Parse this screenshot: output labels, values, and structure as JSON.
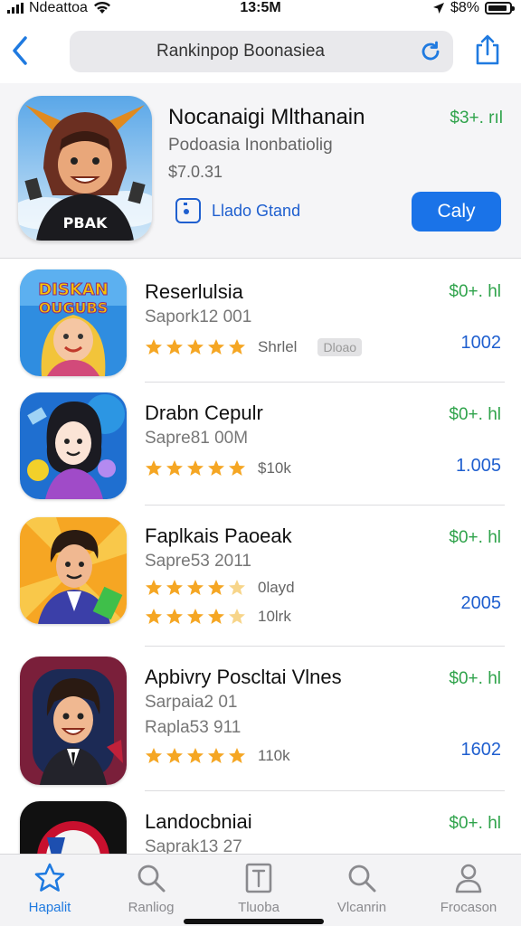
{
  "status_bar": {
    "carrier": "Ndeattoa",
    "time": "13:5M",
    "battery": "$8%"
  },
  "nav": {
    "search_text": "Rankinpop Boonasiea"
  },
  "featured": {
    "title": "Nocanaigi Mlthanain",
    "subtitle": "Podoasia Inonbatiolig",
    "price_detail": "$7.0.31",
    "price": "$3+. rıl",
    "stand_label": "Llado Gtand",
    "get_label": "Caly"
  },
  "apps": [
    {
      "title": "Reserlulsia",
      "sub1": "Sapork12 001",
      "sub2": "",
      "price": "$0+. hl",
      "count": "1002",
      "ratings": [
        {
          "stars": 5,
          "text": "Shrlel"
        }
      ],
      "tag": "Dloao"
    },
    {
      "title": "Drabn Cepulr",
      "sub1": "Sapre81 00M",
      "sub2": "",
      "price": "$0+. hl",
      "count": "1.005",
      "ratings": [
        {
          "stars": 5,
          "text": "$10k"
        }
      ],
      "tag": ""
    },
    {
      "title": "Faplkais Paoeak",
      "sub1": "Sapre53 2011",
      "sub2": "",
      "price": "$0+. hl",
      "count": "2005",
      "ratings": [
        {
          "stars": 4.5,
          "text": "0layd"
        },
        {
          "stars": 4.5,
          "text": "10lrk"
        }
      ],
      "tag": ""
    },
    {
      "title": "Apbivry Poscltai Vlnes",
      "sub1": "Sarpaia2 01",
      "sub2": "Raplа53 911",
      "price": "$0+. hl",
      "count": "1602",
      "ratings": [
        {
          "stars": 5,
          "text": "110k"
        }
      ],
      "tag": ""
    },
    {
      "title": "Landocbniai",
      "sub1": "Saprak13 27",
      "sub2": "",
      "price": "$0+. hl",
      "count": "",
      "ratings": [],
      "tag": ""
    }
  ],
  "tabs": [
    {
      "label": "Hapalit",
      "icon": "star-icon",
      "active": true
    },
    {
      "label": "Ranliog",
      "icon": "search-icon",
      "active": false
    },
    {
      "label": "Tluoba",
      "icon": "document-icon",
      "active": false
    },
    {
      "label": "Vlcanrin",
      "icon": "search-icon",
      "active": false
    },
    {
      "label": "Frocason",
      "icon": "person-icon",
      "active": false
    }
  ],
  "colors": {
    "accent": "#1f7ae0",
    "price_green": "#2fa34b",
    "star": "#f5a623",
    "get_button": "#1a73e8"
  }
}
